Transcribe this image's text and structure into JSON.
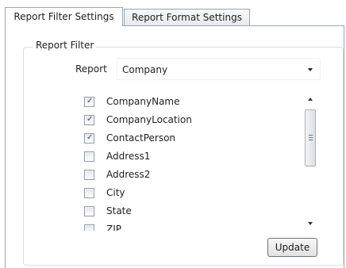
{
  "tabs": [
    {
      "label": "Report Filter Settings",
      "active": true
    },
    {
      "label": "Report Format Settings",
      "active": false
    }
  ],
  "filter_group": {
    "title": "Report Filter",
    "report_label": "Report",
    "report_value": "Company"
  },
  "fields": [
    {
      "label": "CompanyName",
      "checked": true
    },
    {
      "label": "CompanyLocation",
      "checked": true
    },
    {
      "label": "ContactPerson",
      "checked": true
    },
    {
      "label": "Address1",
      "checked": false
    },
    {
      "label": "Address2",
      "checked": false
    },
    {
      "label": "City",
      "checked": false
    },
    {
      "label": "State",
      "checked": false
    },
    {
      "label": "ZIP",
      "checked": false
    }
  ],
  "update_label": "Update",
  "icons": {
    "dropdown": "chevron-down-icon",
    "scroll_up": "scroll-up-icon",
    "scroll_down": "scroll-down-icon",
    "check": "check-icon"
  }
}
